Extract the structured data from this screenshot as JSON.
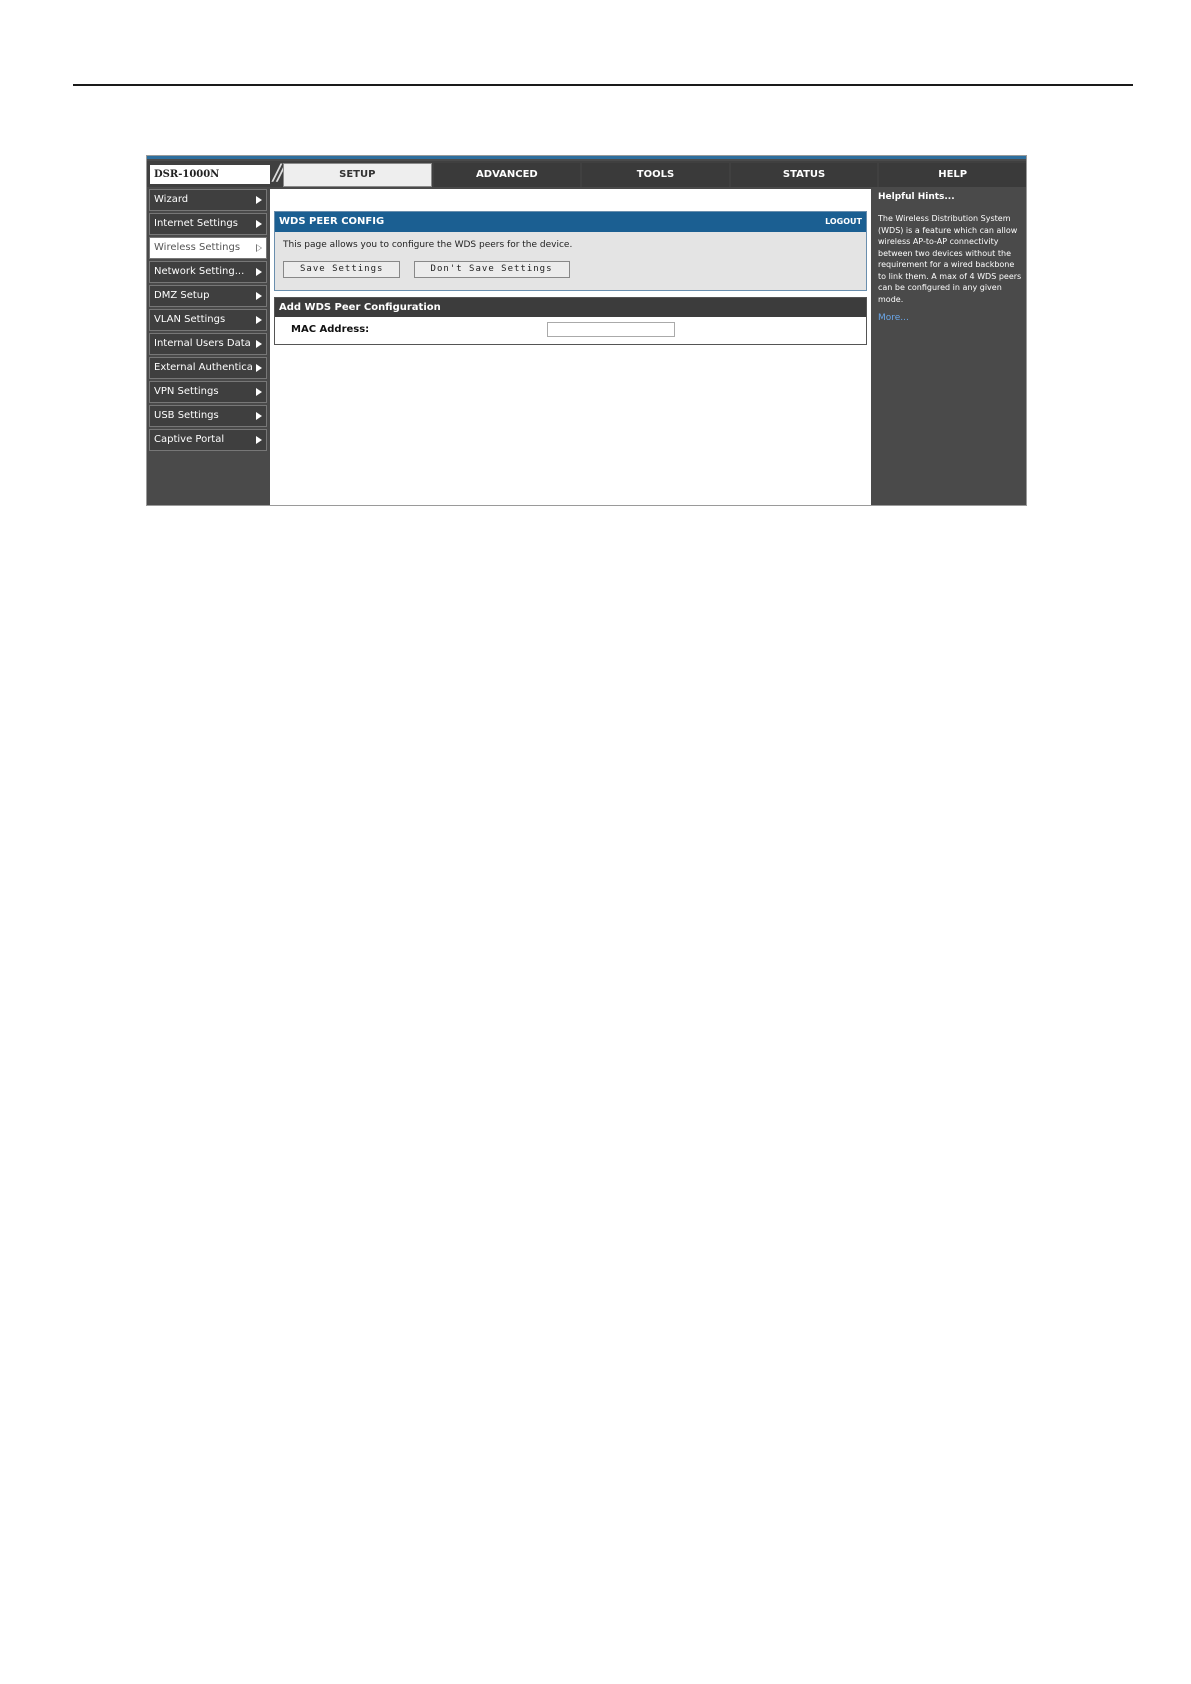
{
  "brand": {
    "model": "DSR-1000N"
  },
  "tabs": [
    {
      "label": "SETUP",
      "active": true
    },
    {
      "label": "ADVANCED",
      "active": false
    },
    {
      "label": "TOOLS",
      "active": false
    },
    {
      "label": "STATUS",
      "active": false
    },
    {
      "label": "HELP",
      "active": false
    }
  ],
  "sidebar": {
    "items": [
      {
        "label": "Wizard"
      },
      {
        "label": "Internet Settings"
      },
      {
        "label": "Wireless Settings",
        "active": true
      },
      {
        "label": "Network Setting..."
      },
      {
        "label": "DMZ Setup"
      },
      {
        "label": "VLAN Settings"
      },
      {
        "label": "Internal Users Data"
      },
      {
        "label": "External Authentica"
      },
      {
        "label": "VPN Settings"
      },
      {
        "label": "USB Settings"
      },
      {
        "label": "Captive Portal"
      }
    ]
  },
  "config": {
    "title": "WDS PEER CONFIG",
    "logout": "LOGOUT",
    "description": "This page allows you to configure the WDS peers for the device.",
    "save_label": "Save Settings",
    "dont_save_label": "Don't Save Settings"
  },
  "add_peer": {
    "title": "Add WDS Peer Configuration",
    "mac_label": "MAC Address:",
    "mac_value": ""
  },
  "help": {
    "title": "Helpful Hints...",
    "text": "The Wireless Distribution System (WDS) is a feature which can allow wireless AP-to-AP connectivity between two devices without the requirement for a wired backbone to link them. A max of 4 WDS peers can be configured in any given mode.",
    "more": "More..."
  },
  "colors": {
    "header_blue": "#1b5f92",
    "panel_dark": "#4a4a4a",
    "link_blue": "#6aa6e8"
  }
}
